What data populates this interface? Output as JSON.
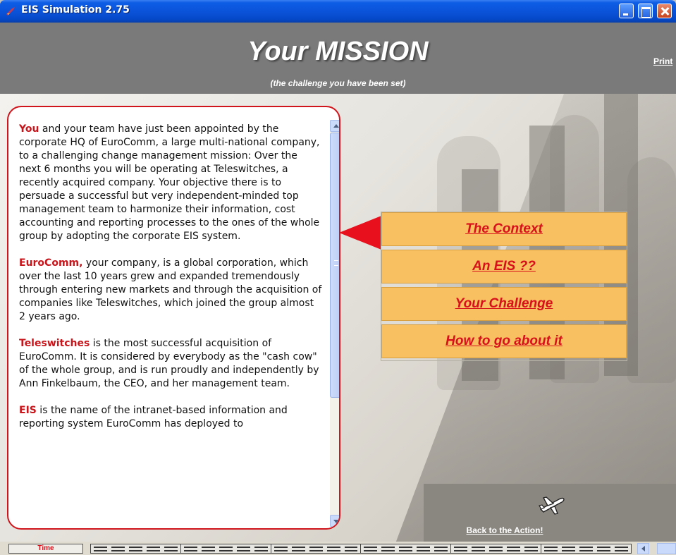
{
  "window": {
    "title": "EIS Simulation 2.75"
  },
  "header": {
    "title": "Your MISSION",
    "subtitle": "(the challenge you have been set)",
    "print_label": "Print"
  },
  "mission_text": [
    {
      "keyword": "You",
      "text": " and your team have just been appointed by the corporate HQ of EuroComm, a large multi-national company, to a challenging change management mission: Over the next 6 months you will be operating at Teleswitches, a recently acquired company. Your objective there is to persuade a successful but very independent-minded top management team to harmonize their information, cost accounting and reporting processes to the ones of the whole group by adopting the corporate EIS system."
    },
    {
      "keyword": "EuroComm,",
      "text": " your company, is a global corporation, which over the last 10 years grew and expanded tremendously through entering new markets and through the acquisition of companies like Teleswitches, which joined the group almost 2 years ago."
    },
    {
      "keyword": "Teleswitches",
      "text": " is the most successful acquisition of EuroComm. It is considered by everybody as the \"cash cow\" of the whole group, and is run proudly and independently by Ann Finkelbaum, the CEO, and her management team."
    },
    {
      "keyword": "EIS",
      "text": " is the name of the intranet-based information and reporting system EuroComm has deployed to"
    }
  ],
  "menu": {
    "items": [
      {
        "label": "The Context"
      },
      {
        "label": "An EIS ??"
      },
      {
        "label": "Your Challenge"
      },
      {
        "label": "How to go about it"
      }
    ]
  },
  "back": {
    "label": "Back to the Action!",
    "icon": "airplane-icon"
  },
  "status": {
    "time_label": "Time",
    "segments": 6
  },
  "colors": {
    "accent_red": "#d0151c",
    "menu_bg": "#f8c060",
    "header_bg": "#7a7a7a"
  }
}
